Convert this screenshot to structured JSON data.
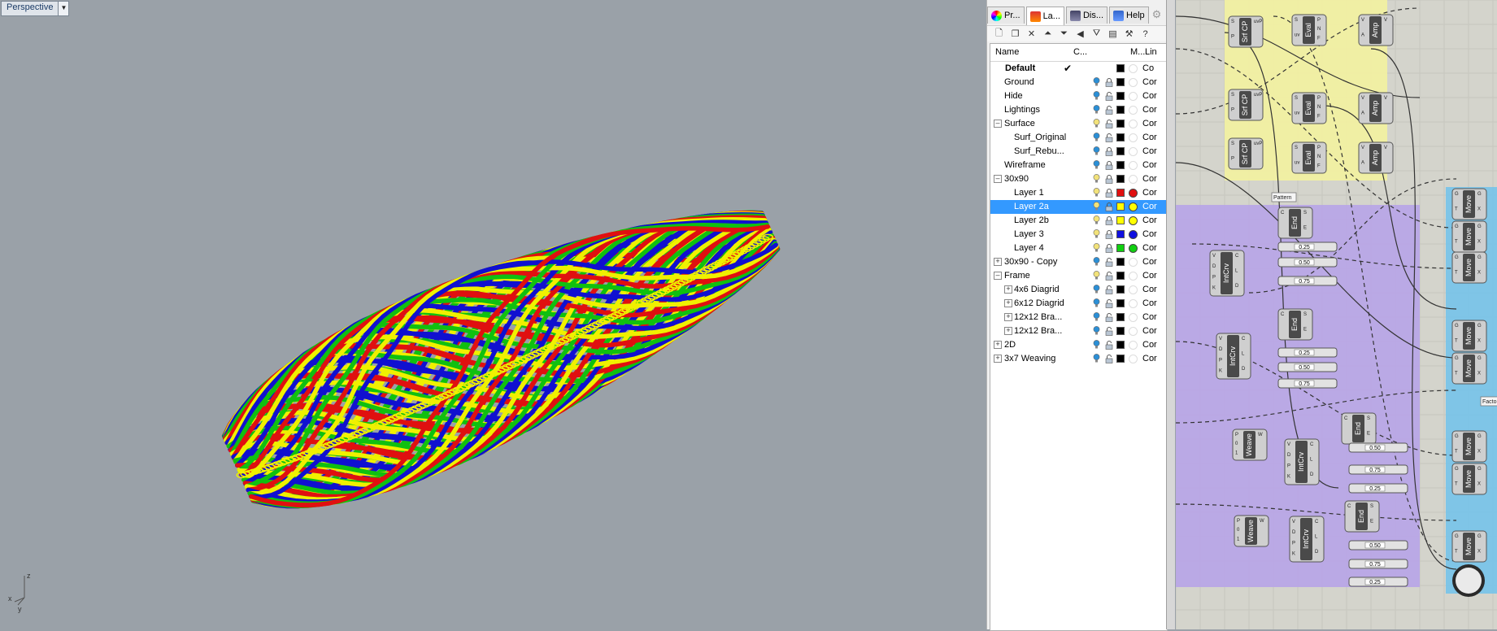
{
  "viewport": {
    "title": "Perspective",
    "axis_labels": {
      "x": "x",
      "y": "y",
      "z": "z"
    },
    "weave_colors": [
      "#e01010",
      "#10c010",
      "#1010d0",
      "#f0f000"
    ]
  },
  "layers_panel": {
    "tabs": [
      {
        "label": "Pr...",
        "icon": "properties-icon",
        "active": false
      },
      {
        "label": "La...",
        "icon": "layers-icon",
        "active": true
      },
      {
        "label": "Dis...",
        "icon": "display-icon",
        "active": false
      },
      {
        "label": "Help",
        "icon": "help-icon",
        "active": false
      }
    ],
    "columns": {
      "name": "Name",
      "current": "C...",
      "material": "M...",
      "linetype": "Lin"
    },
    "layers": [
      {
        "name": "Default",
        "depth": 0,
        "expander": "",
        "current": true,
        "bold": true,
        "color": "#000000",
        "material": "",
        "linetype": "Co",
        "lock": "",
        "bulb": ""
      },
      {
        "name": "Ground",
        "depth": 0,
        "expander": "",
        "color": "#000000",
        "material": "",
        "linetype": "Cor",
        "lock": "locked",
        "bulb": "on"
      },
      {
        "name": "Hide",
        "depth": 0,
        "expander": "",
        "color": "#000000",
        "material": "",
        "linetype": "Cor",
        "lock": "unlocked",
        "bulb": "on"
      },
      {
        "name": "Lightings",
        "depth": 0,
        "expander": "",
        "color": "#000000",
        "material": "",
        "linetype": "Cor",
        "lock": "unlocked",
        "bulb": "on"
      },
      {
        "name": "Surface",
        "depth": 0,
        "expander": "−",
        "color": "#000000",
        "material": "",
        "linetype": "Cor",
        "lock": "unlocked",
        "bulb": "yellow"
      },
      {
        "name": "Surf_Original",
        "depth": 1,
        "expander": "",
        "color": "#000000",
        "material": "",
        "linetype": "Cor",
        "lock": "unlocked",
        "bulb": "on"
      },
      {
        "name": "Surf_Rebu...",
        "depth": 1,
        "expander": "",
        "color": "#000000",
        "material": "",
        "linetype": "Cor",
        "lock": "locked",
        "bulb": "on"
      },
      {
        "name": "Wireframe",
        "depth": 0,
        "expander": "",
        "color": "#000000",
        "material": "",
        "linetype": "Cor",
        "lock": "locked",
        "bulb": "on"
      },
      {
        "name": "30x90",
        "depth": 0,
        "expander": "−",
        "color": "#000000",
        "material": "",
        "linetype": "Cor",
        "lock": "locked",
        "bulb": "yellow"
      },
      {
        "name": "Layer 1",
        "depth": 1,
        "expander": "",
        "color": "#e01010",
        "material": "#e01010",
        "linetype": "Cor",
        "lock": "locked",
        "bulb": "yellow"
      },
      {
        "name": "Layer 2a",
        "depth": 1,
        "expander": "",
        "selected": true,
        "color": "#ffff00",
        "material": "#ffff00",
        "linetype": "Cor",
        "lock": "locked",
        "bulb": "yellow"
      },
      {
        "name": "Layer 2b",
        "depth": 1,
        "expander": "",
        "color": "#ffff00",
        "material": "#ffff00",
        "linetype": "Cor",
        "lock": "locked",
        "bulb": "yellow"
      },
      {
        "name": "Layer 3",
        "depth": 1,
        "expander": "",
        "color": "#1010e0",
        "material": "#1010e0",
        "linetype": "Cor",
        "lock": "locked",
        "bulb": "yellow"
      },
      {
        "name": "Layer 4",
        "depth": 1,
        "expander": "",
        "color": "#10d010",
        "material": "#10d010",
        "linetype": "Cor",
        "lock": "locked",
        "bulb": "yellow"
      },
      {
        "name": "30x90 - Copy",
        "depth": 0,
        "expander": "+",
        "color": "#000000",
        "material": "",
        "linetype": "Cor",
        "lock": "unlocked",
        "bulb": "on"
      },
      {
        "name": "Frame",
        "depth": 0,
        "expander": "−",
        "color": "#000000",
        "material": "",
        "linetype": "Cor",
        "lock": "unlocked",
        "bulb": "yellow"
      },
      {
        "name": "4x6 Diagrid",
        "depth": 1,
        "expander": "+",
        "color": "#000000",
        "material": "",
        "linetype": "Cor",
        "lock": "unlocked",
        "bulb": "on"
      },
      {
        "name": "6x12 Diagrid",
        "depth": 1,
        "expander": "+",
        "color": "#000000",
        "material": "",
        "linetype": "Cor",
        "lock": "unlocked",
        "bulb": "on"
      },
      {
        "name": "12x12 Bra...",
        "depth": 1,
        "expander": "+",
        "color": "#000000",
        "material": "",
        "linetype": "Cor",
        "lock": "unlocked",
        "bulb": "on"
      },
      {
        "name": "12x12 Bra...",
        "depth": 1,
        "expander": "+",
        "color": "#000000",
        "material": "",
        "linetype": "Cor",
        "lock": "unlocked",
        "bulb": "on"
      },
      {
        "name": "2D",
        "depth": 0,
        "expander": "+",
        "color": "#000000",
        "material": "",
        "linetype": "Cor",
        "lock": "unlocked",
        "bulb": "on"
      },
      {
        "name": "3x7 Weaving",
        "depth": 0,
        "expander": "+",
        "color": "#000000",
        "material": "",
        "linetype": "Cor",
        "lock": "unlocked",
        "bulb": "on"
      }
    ]
  },
  "grasshopper": {
    "groups": [
      {
        "name": "yellow-group",
        "color": "#f3f2a0"
      },
      {
        "name": "purple-group",
        "color": "#b7a4e8"
      },
      {
        "name": "blue-group",
        "color": "#76c3ea"
      }
    ],
    "components": [
      {
        "label": "Srf CP",
        "group": 0,
        "inputs": "S P",
        "outputs": "uvP"
      },
      {
        "label": "Eval",
        "group": 0,
        "inputs": "S uv",
        "outputs": "P N F"
      },
      {
        "label": "Amp",
        "group": 0,
        "inputs": "V A",
        "outputs": "V"
      },
      {
        "label": "Srf CP",
        "group": 0,
        "inputs": "S P",
        "outputs": "uvP"
      },
      {
        "label": "Eval",
        "group": 0,
        "inputs": "S uv",
        "outputs": "P N F"
      },
      {
        "label": "Amp",
        "group": 0,
        "inputs": "V A",
        "outputs": "V"
      },
      {
        "label": "Srf CP",
        "group": 0,
        "inputs": "S P",
        "outputs": "uvP"
      },
      {
        "label": "Eval",
        "group": 0,
        "inputs": "S uv",
        "outputs": "P N F"
      },
      {
        "label": "Amp",
        "group": 0,
        "inputs": "V A",
        "outputs": "V"
      },
      {
        "label": "End",
        "group": 1,
        "inputs": "C",
        "outputs": "S E"
      },
      {
        "label": "IntCrv",
        "group": 1,
        "inputs": "V D P K",
        "outputs": "C L D"
      },
      {
        "label": "End",
        "group": 1,
        "inputs": "C",
        "outputs": "S E"
      },
      {
        "label": "IntCrv",
        "group": 1,
        "inputs": "V D P K",
        "outputs": "C L D"
      },
      {
        "label": "Weave",
        "group": 1,
        "inputs": "P 0 1",
        "outputs": "W"
      },
      {
        "label": "IntCrv",
        "group": 1,
        "inputs": "V D P K",
        "outputs": "C L D"
      },
      {
        "label": "End",
        "group": 1,
        "inputs": "C",
        "outputs": "S E"
      },
      {
        "label": "Weave",
        "group": 1,
        "inputs": "P 0 1",
        "outputs": "W"
      },
      {
        "label": "IntCrv",
        "group": 1,
        "inputs": "V D P K",
        "outputs": "C L D"
      },
      {
        "label": "End",
        "group": 1,
        "inputs": "C",
        "outputs": "S E"
      },
      {
        "label": "Move",
        "group": 2,
        "inputs": "G T",
        "outputs": "G X"
      },
      {
        "label": "Move",
        "group": 2,
        "inputs": "G T",
        "outputs": "G X"
      },
      {
        "label": "Move",
        "group": 2,
        "inputs": "G T",
        "outputs": "G X"
      },
      {
        "label": "Move",
        "group": 2,
        "inputs": "G T",
        "outputs": "G X"
      },
      {
        "label": "Move",
        "group": 2,
        "inputs": "G T",
        "outputs": "G X"
      },
      {
        "label": "Move",
        "group": 2,
        "inputs": "G T",
        "outputs": "G X"
      },
      {
        "label": "Move",
        "group": 2,
        "inputs": "G T",
        "outputs": "G X"
      },
      {
        "label": "Move",
        "group": 2,
        "inputs": "G T",
        "outputs": "G X"
      }
    ],
    "sliders": [
      "0.25",
      "0.50",
      "0.75",
      "0.25",
      "0.50",
      "0.75",
      "0.50",
      "0.75",
      "0.25",
      "0.50",
      "0.75",
      "0.25"
    ],
    "panel_labels": [
      "Pattern",
      "Facto"
    ]
  }
}
